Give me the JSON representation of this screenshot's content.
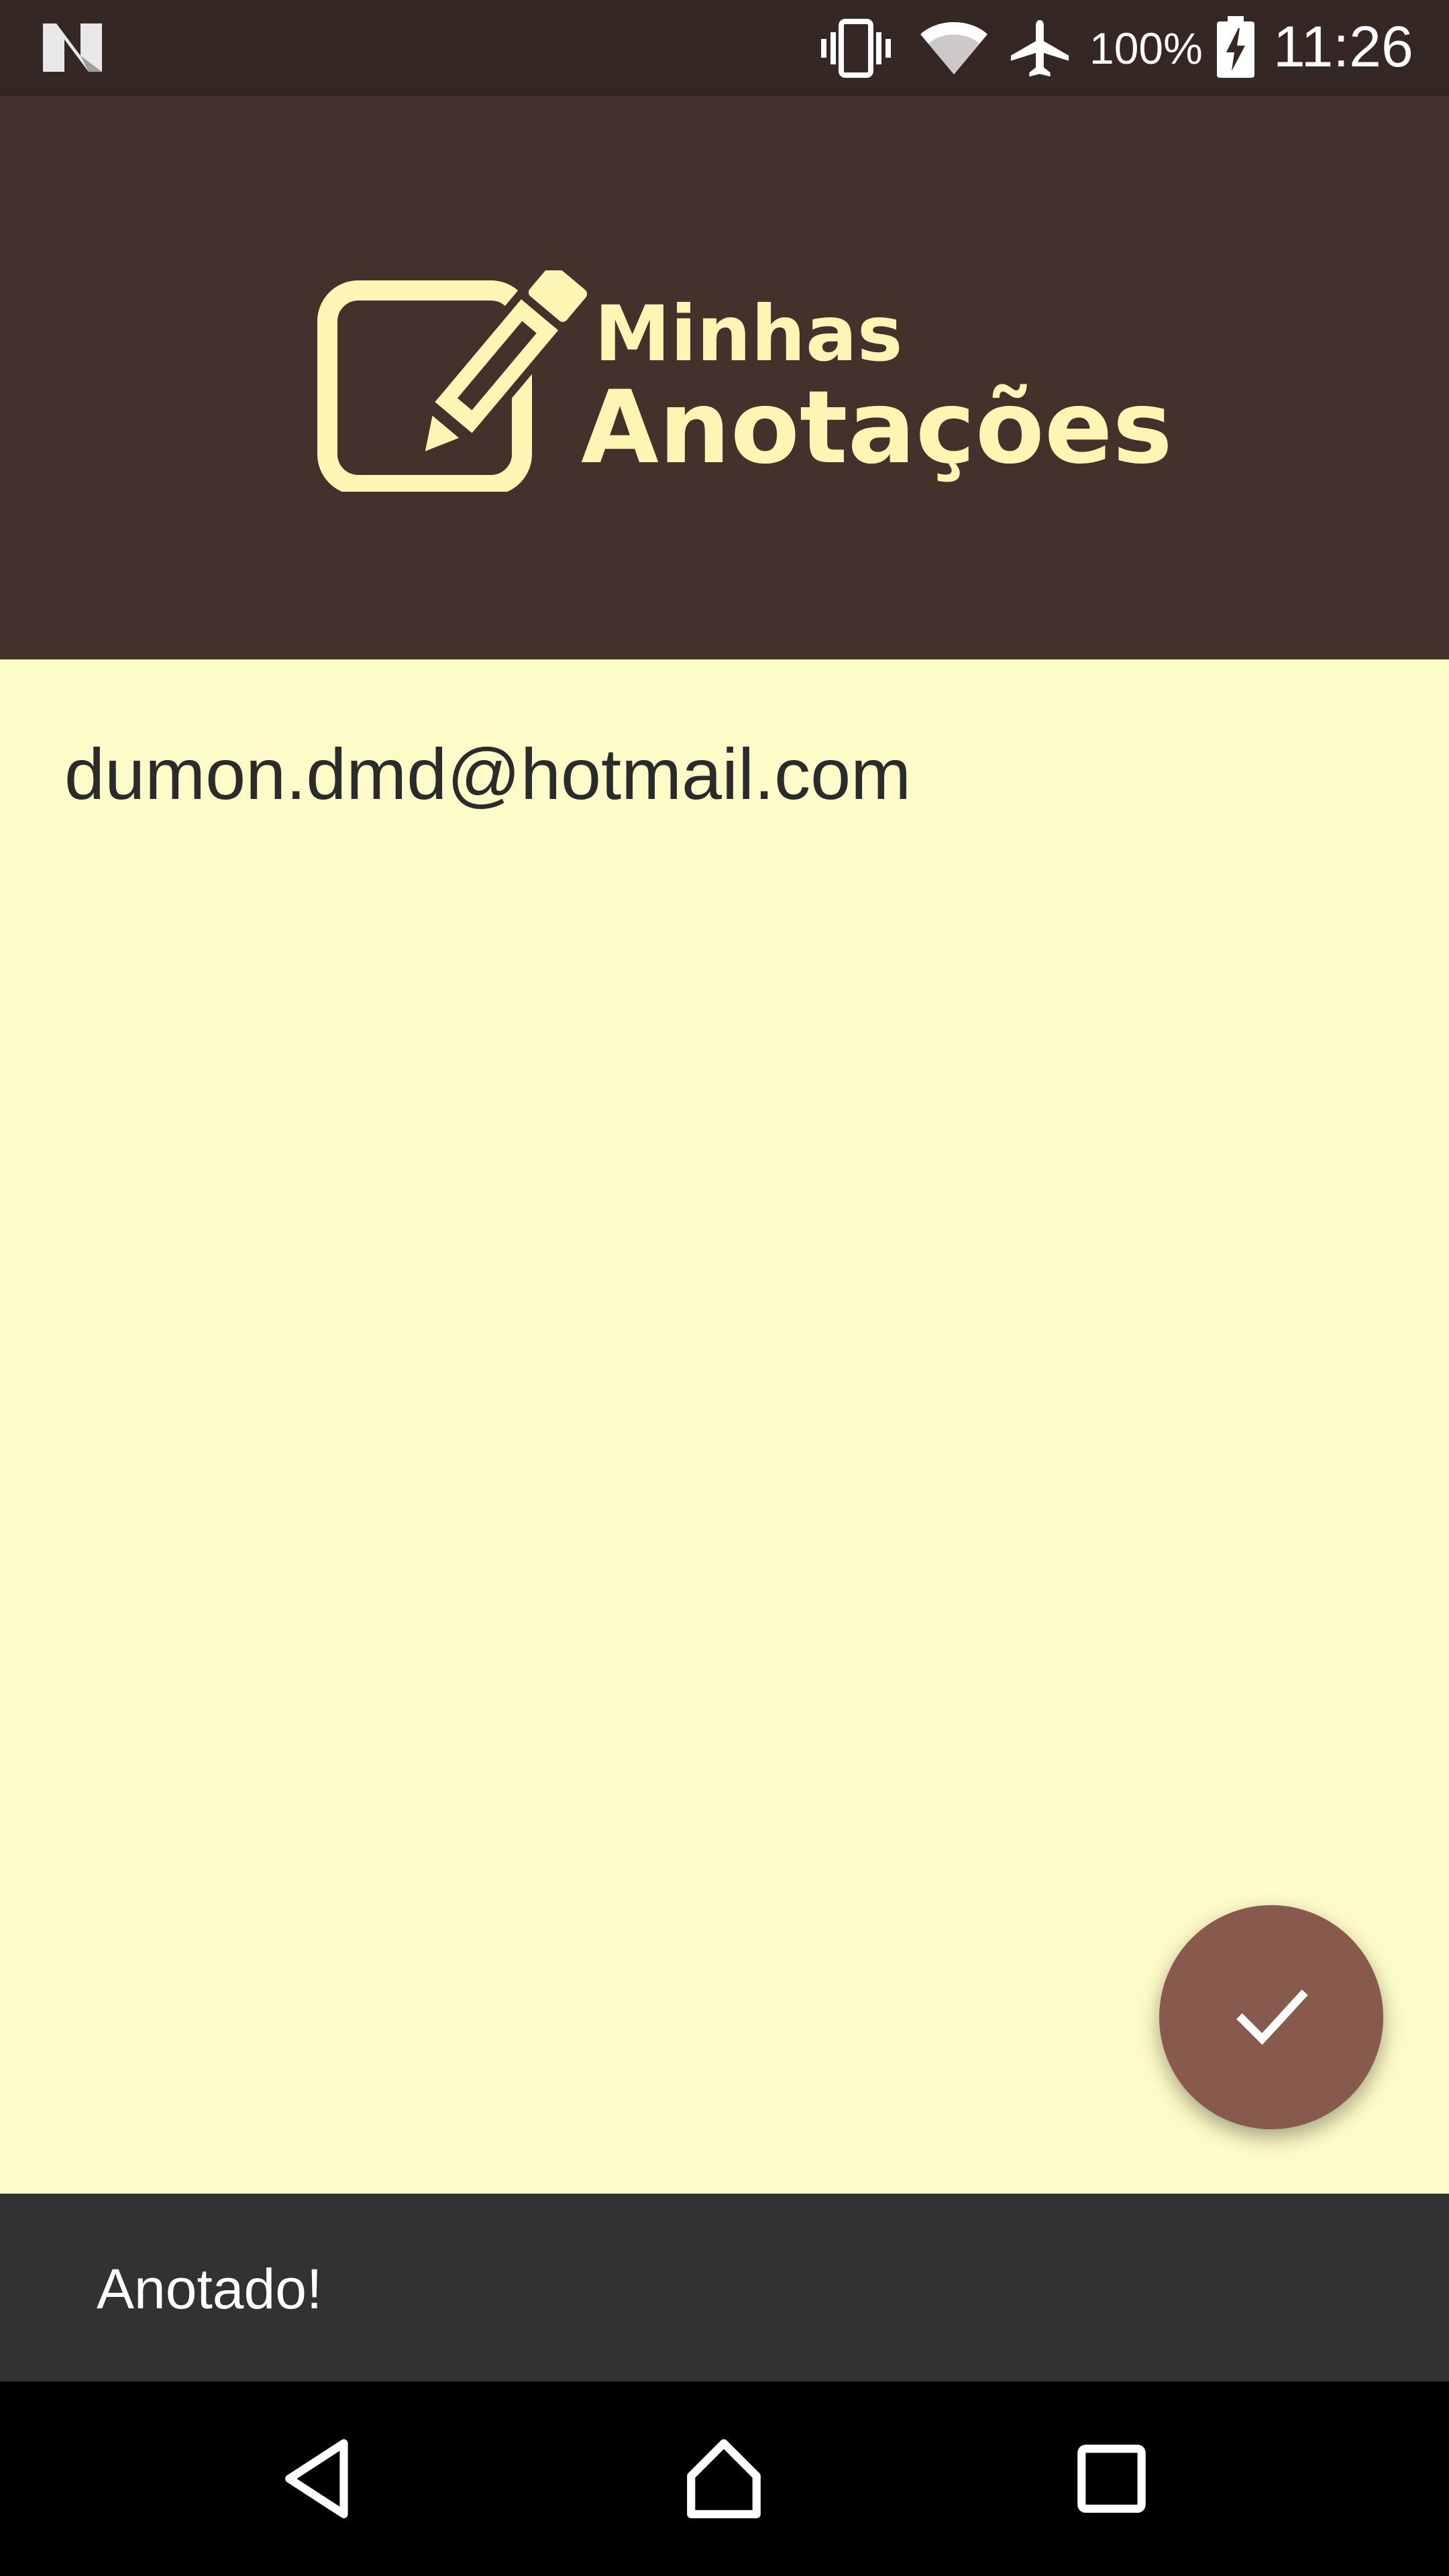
{
  "status_bar": {
    "battery_percent": "100%",
    "time": "11:26",
    "icons": [
      "n-notification-icon",
      "vibrate-icon",
      "wifi-icon",
      "airplane-mode-icon",
      "battery-charging-icon"
    ]
  },
  "header": {
    "logo_line1": "Minhas",
    "logo_line2": "Anotações",
    "logo_icon": "edit-note-icon"
  },
  "note": {
    "text": "dumon.dmd@hotmail.com"
  },
  "fab": {
    "icon": "check-icon",
    "color": "#875A4D"
  },
  "snackbar": {
    "message": "Anotado!"
  },
  "nav_bar": {
    "icons": [
      "back-icon",
      "home-icon",
      "recents-icon"
    ]
  },
  "colors": {
    "status_bar": "#352723",
    "header": "#45302C",
    "note_background": "#FDFBC7",
    "logo": "#FDF5B4",
    "snackbar": "#323232"
  }
}
